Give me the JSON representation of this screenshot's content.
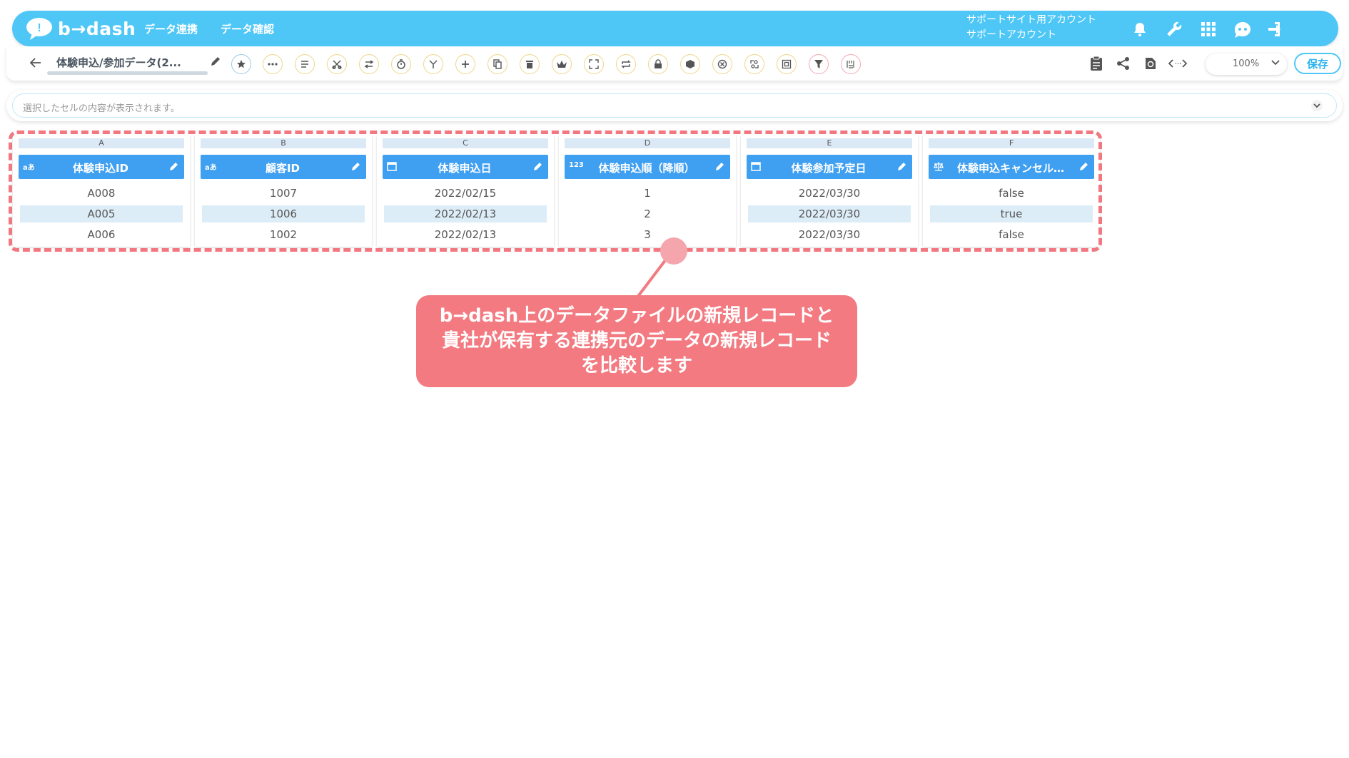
{
  "header": {
    "logo_text": "b→dash",
    "nav": [
      "データ連携",
      "データ確認"
    ],
    "account": [
      "サポートサイト用アカウント",
      "サポートアカウント"
    ],
    "icons": [
      "bell-icon",
      "wrench-icon",
      "grid-icon",
      "assistant-icon",
      "logout-icon"
    ],
    "color": "#4ec7f7"
  },
  "toolbar": {
    "title": "体験申込/参加データ(2...",
    "tools": [
      "star-icon",
      "more-icon",
      "list-icon",
      "scissors-icon",
      "swap-icon",
      "timer-icon",
      "merge-icon",
      "add-icon",
      "copy-icon",
      "trash-icon",
      "crown-icon",
      "expand-icon",
      "repeat-icon",
      "lock-icon",
      "box-icon",
      "close-circle-icon",
      "ab-icon",
      "frame-icon",
      "filter-icon",
      "pattern-icon"
    ],
    "right_icons": [
      "clipboard-icon",
      "share-icon",
      "refresh-icon",
      "code-icon"
    ],
    "zoom": "100%",
    "save_label": "保存"
  },
  "cellbar": {
    "placeholder": "選択したセルの内容が表示されます。"
  },
  "table": {
    "columns": [
      {
        "letter": "A",
        "type": "aあ",
        "name": "体験申込ID",
        "values": [
          "A008",
          "A005",
          "A006"
        ]
      },
      {
        "letter": "B",
        "type": "aあ",
        "name": "顧客ID",
        "values": [
          "1007",
          "1006",
          "1002"
        ]
      },
      {
        "letter": "C",
        "type": "calendar",
        "name": "体験申込日",
        "values": [
          "2022/02/15",
          "2022/02/13",
          "2022/02/13"
        ]
      },
      {
        "letter": "D",
        "type": "123",
        "name": "体験申込順（降順）",
        "values": [
          "1",
          "2",
          "3"
        ]
      },
      {
        "letter": "E",
        "type": "calendar",
        "name": "体験参加予定日",
        "values": [
          "2022/03/30",
          "2022/03/30",
          "2022/03/30"
        ]
      },
      {
        "letter": "F",
        "type": "bool",
        "name": "体験申込キャンセル…",
        "values": [
          "false",
          "true",
          "false"
        ]
      }
    ],
    "header_color": "#3f9ff1"
  },
  "annotation": {
    "lines": [
      "b→dash上のデータファイルの新規レコードと",
      "貴社が保有する連携元のデータの新規レコード",
      "を比較します"
    ],
    "color": "#f27a80"
  }
}
